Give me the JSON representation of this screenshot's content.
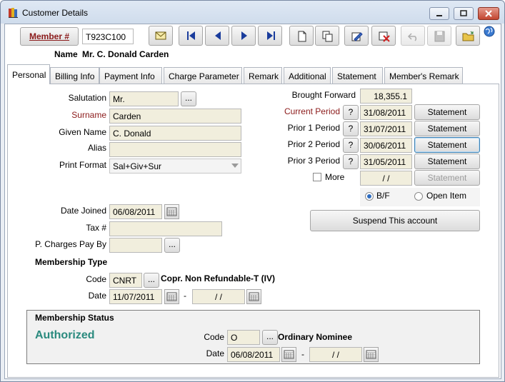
{
  "window": {
    "title": "Customer Details"
  },
  "header": {
    "member_button": "Member #",
    "member_number": "T923C100",
    "name_label": "Name",
    "name_value": "Mr. C. Donald Carden"
  },
  "tabs": [
    "Personal",
    "Billing Info",
    "Payment Info",
    "Charge Parameter",
    "Remark",
    "Additional",
    "Statement",
    "Member's Remark"
  ],
  "personal": {
    "salutation_label": "Salutation",
    "salutation_value": "Mr.",
    "surname_label": "Surname",
    "surname_value": "Carden",
    "given_name_label": "Given Name",
    "given_name_value": "C. Donald",
    "alias_label": "Alias",
    "alias_value": "",
    "print_format_label": "Print Format",
    "print_format_value": "Sal+Giv+Sur",
    "date_joined_label": "Date Joined",
    "date_joined_value": "06/08/2011",
    "tax_label": "Tax #",
    "tax_value": "",
    "pcharges_label": "P. Charges Pay By",
    "pcharges_value": ""
  },
  "membership_type": {
    "heading": "Membership Type",
    "code_label": "Code",
    "code_value": "CNRT",
    "code_desc": "Copr. Non Refundable-T (IV)",
    "date_label": "Date",
    "date_from": "11/07/2011",
    "date_sep": "-",
    "date_to": " /  /"
  },
  "balances": {
    "brought_forward_label": "Brought Forward",
    "brought_forward_value": "18,355.1",
    "periods": [
      {
        "label": "Current Period",
        "date": "31/08/2011",
        "button": "Statement"
      },
      {
        "label": "Prior 1 Period",
        "date": "31/07/2011",
        "button": "Statement"
      },
      {
        "label": "Prior 2 Period",
        "date": "30/06/2011",
        "button": "Statement"
      },
      {
        "label": "Prior 3 Period",
        "date": "31/05/2011",
        "button": "Statement"
      }
    ],
    "more_label": "More",
    "more_date": " /  /",
    "more_button": "Statement",
    "question": "?",
    "bf_label": "B/F",
    "open_item_label": "Open Item",
    "suspend_button": "Suspend This account"
  },
  "membership_status": {
    "heading": "Membership Status",
    "status": "Authorized",
    "code_label": "Code",
    "code_value": "O",
    "code_desc": "Ordinary Nominee",
    "date_label": "Date",
    "date_from": "06/08/2011",
    "date_sep": "-",
    "date_to": " /  /"
  },
  "misc": {
    "ellipsis": "..."
  },
  "colors": {
    "accent_status": "#2a8a7e",
    "field_bg": "#f1eedd",
    "required_label": "#8b1a1a"
  }
}
